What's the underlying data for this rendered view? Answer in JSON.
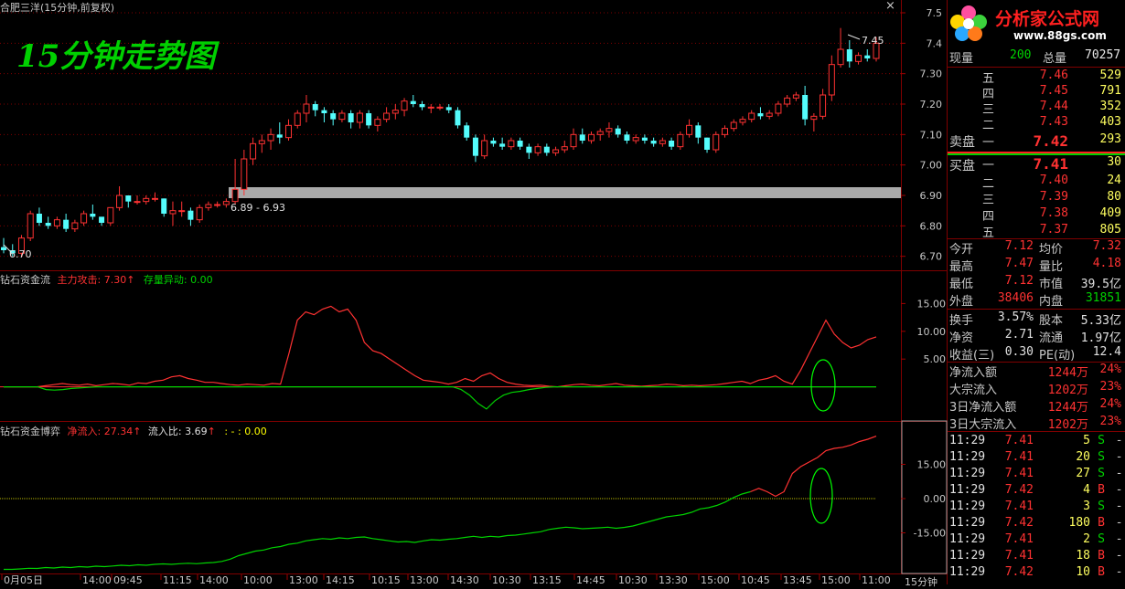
{
  "window": {
    "title": "合肥三洋(15分钟,前复权)",
    "close_label": "×"
  },
  "overlay": {
    "title": "15分钟走势图"
  },
  "watermark": {
    "brand": "分析家公式网",
    "url": "www.88gs.com"
  },
  "colors": {
    "up": "#ff3232",
    "down": "#54fcfc",
    "green": "#00d200",
    "yellow": "#ffff00",
    "grid": "#800000"
  },
  "main_chart": {
    "y_ticks": [
      "7.5",
      "7.4",
      "7.30",
      "7.20",
      "7.10",
      "7.00",
      "6.90",
      "6.80",
      "6.70"
    ],
    "high_label": "7.45",
    "low_label": "6.70",
    "band_label": "6.89 - 6.93",
    "time_label": "11:00"
  },
  "chart_data": [
    {
      "type": "candlestick",
      "title": "合肥三洋(15分钟,前复权)",
      "ylim": [
        6.66,
        7.53
      ],
      "ohlc": [
        [
          6.73,
          6.76,
          6.71,
          6.72
        ],
        [
          6.72,
          6.74,
          6.7,
          6.71
        ],
        [
          6.71,
          6.77,
          6.7,
          6.76
        ],
        [
          6.76,
          6.85,
          6.75,
          6.84
        ],
        [
          6.84,
          6.86,
          6.8,
          6.81
        ],
        [
          6.81,
          6.83,
          6.79,
          6.8
        ],
        [
          6.8,
          6.83,
          6.79,
          6.82
        ],
        [
          6.82,
          6.84,
          6.78,
          6.79
        ],
        [
          6.79,
          6.82,
          6.78,
          6.81
        ],
        [
          6.81,
          6.85,
          6.8,
          6.84
        ],
        [
          6.84,
          6.87,
          6.82,
          6.83
        ],
        [
          6.83,
          6.82,
          6.8,
          6.81
        ],
        [
          6.81,
          6.86,
          6.8,
          6.86
        ],
        [
          6.86,
          6.93,
          6.85,
          6.9
        ],
        [
          6.9,
          6.9,
          6.86,
          6.88
        ],
        [
          6.88,
          6.9,
          6.87,
          6.88
        ],
        [
          6.88,
          6.9,
          6.87,
          6.89
        ],
        [
          6.89,
          6.91,
          6.88,
          6.89
        ],
        [
          6.89,
          6.89,
          6.83,
          6.84
        ],
        [
          6.84,
          6.88,
          6.8,
          6.85
        ],
        [
          6.85,
          6.88,
          6.83,
          6.85
        ],
        [
          6.85,
          6.86,
          6.8,
          6.82
        ],
        [
          6.82,
          6.87,
          6.81,
          6.86
        ],
        [
          6.86,
          6.88,
          6.85,
          6.87
        ],
        [
          6.87,
          6.88,
          6.86,
          6.87
        ],
        [
          6.87,
          6.89,
          6.86,
          6.88
        ],
        [
          6.88,
          7.02,
          6.87,
          6.92
        ],
        [
          6.92,
          7.05,
          6.9,
          7.02
        ],
        [
          7.02,
          7.09,
          7.0,
          7.07
        ],
        [
          7.07,
          7.1,
          7.04,
          7.08
        ],
        [
          7.08,
          7.12,
          7.05,
          7.1
        ],
        [
          7.1,
          7.14,
          7.07,
          7.09
        ],
        [
          7.09,
          7.15,
          7.08,
          7.13
        ],
        [
          7.13,
          7.18,
          7.12,
          7.17
        ],
        [
          7.17,
          7.23,
          7.14,
          7.2
        ],
        [
          7.2,
          7.21,
          7.16,
          7.18
        ],
        [
          7.18,
          7.19,
          7.14,
          7.17
        ],
        [
          7.17,
          7.18,
          7.13,
          7.15
        ],
        [
          7.15,
          7.18,
          7.14,
          7.17
        ],
        [
          7.17,
          7.18,
          7.12,
          7.14
        ],
        [
          7.14,
          7.18,
          7.12,
          7.17
        ],
        [
          7.17,
          7.18,
          7.12,
          7.13
        ],
        [
          7.13,
          7.16,
          7.11,
          7.15
        ],
        [
          7.15,
          7.19,
          7.14,
          7.17
        ],
        [
          7.17,
          7.2,
          7.15,
          7.18
        ],
        [
          7.18,
          7.22,
          7.16,
          7.21
        ],
        [
          7.21,
          7.23,
          7.19,
          7.2
        ],
        [
          7.2,
          7.21,
          7.18,
          7.19
        ],
        [
          7.19,
          7.2,
          7.17,
          7.19
        ],
        [
          7.19,
          7.2,
          7.18,
          7.19
        ],
        [
          7.19,
          7.2,
          7.17,
          7.18
        ],
        [
          7.18,
          7.19,
          7.12,
          7.13
        ],
        [
          7.13,
          7.14,
          7.08,
          7.09
        ],
        [
          7.09,
          7.1,
          7.01,
          7.03
        ],
        [
          7.03,
          7.1,
          7.02,
          7.08
        ],
        [
          7.08,
          7.09,
          7.06,
          7.07
        ],
        [
          7.07,
          7.09,
          7.05,
          7.06
        ],
        [
          7.06,
          7.09,
          7.05,
          7.08
        ],
        [
          7.08,
          7.09,
          7.05,
          7.06
        ],
        [
          7.06,
          7.07,
          7.02,
          7.04
        ],
        [
          7.04,
          7.07,
          7.03,
          7.06
        ],
        [
          7.06,
          7.07,
          7.03,
          7.04
        ],
        [
          7.04,
          7.06,
          7.03,
          7.05
        ],
        [
          7.05,
          7.08,
          7.04,
          7.06
        ],
        [
          7.06,
          7.12,
          7.05,
          7.1
        ],
        [
          7.1,
          7.12,
          7.07,
          7.08
        ],
        [
          7.08,
          7.11,
          7.07,
          7.1
        ],
        [
          7.1,
          7.12,
          7.08,
          7.11
        ],
        [
          7.11,
          7.14,
          7.09,
          7.12
        ],
        [
          7.12,
          7.13,
          7.09,
          7.1
        ],
        [
          7.1,
          7.11,
          7.07,
          7.08
        ],
        [
          7.08,
          7.1,
          7.07,
          7.09
        ],
        [
          7.09,
          7.1,
          7.07,
          7.08
        ],
        [
          7.08,
          7.09,
          7.06,
          7.07
        ],
        [
          7.07,
          7.09,
          7.06,
          7.08
        ],
        [
          7.08,
          7.09,
          7.05,
          7.06
        ],
        [
          7.06,
          7.11,
          7.05,
          7.1
        ],
        [
          7.1,
          7.15,
          7.09,
          7.13
        ],
        [
          7.13,
          7.14,
          7.07,
          7.09
        ],
        [
          7.09,
          7.09,
          7.04,
          7.05
        ],
        [
          7.05,
          7.11,
          7.04,
          7.1
        ],
        [
          7.1,
          7.13,
          7.09,
          7.12
        ],
        [
          7.12,
          7.15,
          7.11,
          7.14
        ],
        [
          7.14,
          7.16,
          7.13,
          7.15
        ],
        [
          7.15,
          7.18,
          7.14,
          7.17
        ],
        [
          7.17,
          7.19,
          7.15,
          7.16
        ],
        [
          7.16,
          7.18,
          7.15,
          7.17
        ],
        [
          7.17,
          7.21,
          7.16,
          7.2
        ],
        [
          7.2,
          7.23,
          7.19,
          7.22
        ],
        [
          7.22,
          7.24,
          7.21,
          7.23
        ],
        [
          7.23,
          7.26,
          7.13,
          7.15
        ],
        [
          7.15,
          7.17,
          7.11,
          7.16
        ],
        [
          7.16,
          7.25,
          7.15,
          7.23
        ],
        [
          7.23,
          7.36,
          7.21,
          7.33
        ],
        [
          7.33,
          7.45,
          7.32,
          7.38
        ],
        [
          7.38,
          7.41,
          7.32,
          7.34
        ],
        [
          7.34,
          7.37,
          7.33,
          7.36
        ],
        [
          7.36,
          7.38,
          7.34,
          7.35
        ],
        [
          7.35,
          7.42,
          7.34,
          7.4
        ]
      ],
      "ylabel": "",
      "xlabel": ""
    },
    {
      "type": "line",
      "title": "钻石资金流",
      "ylim": [
        -5,
        20
      ],
      "y_ticks": [
        15.0,
        10.0,
        5.0
      ],
      "series": [
        {
          "name": "主力攻击",
          "color": "red",
          "values": [
            0,
            0,
            0,
            0,
            0,
            0.2,
            0.4,
            0.6,
            0.4,
            0.3,
            0.5,
            0.2,
            0.4,
            0.6,
            0.5,
            0.3,
            0.7,
            0.6,
            1.0,
            1.2,
            1.8,
            2.0,
            1.5,
            1.2,
            0.8,
            0.8,
            0.6,
            0.4,
            0.3,
            0.5,
            0.4,
            0.3,
            0.6,
            0.5,
            6.0,
            12.0,
            13.5,
            13.0,
            14.0,
            14.5,
            13.5,
            14.0,
            12.0,
            8.0,
            6.5,
            6.0,
            5.0,
            4.0,
            3.0,
            2.0,
            1.2,
            1.0,
            0.8,
            0.5,
            0.8,
            1.5,
            1.0,
            2.0,
            2.5,
            1.5,
            0.8,
            0.5,
            0.3,
            0.2,
            0.3,
            0.1,
            0,
            0.2,
            0.4,
            0.5,
            0.3,
            0.2,
            0.4,
            0.6,
            0.3,
            0.2,
            0.1,
            0.2,
            0.3,
            0.5,
            0.4,
            0.2,
            0.3,
            0.2,
            0.3,
            0.4,
            0.6,
            0.8,
            1.0,
            0.6,
            1.2,
            1.5,
            2.0,
            1.0,
            0.5,
            3.0,
            6.0,
            9.0,
            12.0,
            9.5,
            8.0,
            7.0,
            7.5,
            8.5,
            9.0
          ]
        },
        {
          "name": "存量异动",
          "color": "green",
          "values": [
            0,
            0,
            0,
            0,
            0,
            -0.5,
            -0.6,
            -0.5,
            -0.3,
            -0.2,
            -0.1,
            0,
            0,
            0,
            0,
            0,
            0,
            0,
            0,
            0,
            0,
            0,
            0,
            0,
            0,
            0,
            0,
            0,
            0,
            0,
            0,
            0,
            0,
            0,
            0,
            0,
            0,
            0,
            0,
            0,
            0,
            0,
            0,
            0,
            0,
            0,
            0,
            0,
            0,
            0,
            0,
            0,
            0,
            0,
            -0.5,
            -1.5,
            -3.0,
            -4.0,
            -2.5,
            -1.5,
            -1.0,
            -0.8,
            -0.5,
            -0.3,
            -0.1,
            0,
            0,
            0,
            0,
            0,
            0,
            0,
            0,
            0,
            0,
            0,
            0,
            0,
            0,
            0,
            0,
            0,
            0,
            0,
            0,
            0,
            0,
            0,
            0,
            0,
            0,
            0,
            0,
            0,
            0,
            0,
            0,
            0,
            0,
            0,
            0,
            0,
            0,
            0
          ]
        }
      ],
      "xlabel": "",
      "ylabel": ""
    },
    {
      "type": "line",
      "title": "钻石资金博弈",
      "ylim": [
        -32,
        32
      ],
      "y_ticks": [
        15.0,
        0.0,
        -15.0
      ],
      "series": [
        {
          "name": "净流入",
          "color": "green",
          "values": [
            -31,
            -31,
            -30.8,
            -30.5,
            -30.6,
            -30.2,
            -30.4,
            -30.0,
            -30.2,
            -29.8,
            -30.0,
            -29.6,
            -29.8,
            -29.5,
            -29.2,
            -29.4,
            -29.0,
            -29.2,
            -28.8,
            -28.6,
            -28.8,
            -28.5,
            -28.3,
            -28.5,
            -28.2,
            -28.0,
            -27.5,
            -26.5,
            -25.0,
            -24.0,
            -23.0,
            -22.5,
            -21.5,
            -21.0,
            -20.0,
            -19.5,
            -18.5,
            -18.0,
            -17.5,
            -17.8,
            -17.2,
            -17.5,
            -17.0,
            -16.8,
            -17.5,
            -18.0,
            -18.5,
            -19.0,
            -18.8,
            -19.2,
            -18.5,
            -18.0,
            -18.2,
            -17.8,
            -17.5,
            -17.0,
            -16.5,
            -17.0,
            -16.5,
            -16.8,
            -16.2,
            -16.0,
            -15.5,
            -15.0,
            -14.5,
            -13.5,
            -13.0,
            -12.5,
            -12.8,
            -13.2,
            -13.0,
            -12.8,
            -12.5,
            -13.0,
            -12.6,
            -12.0,
            -11.0,
            -10.0,
            -9.0,
            -8.0,
            -7.5,
            -7.0,
            -6.0,
            -4.5,
            -4.0,
            -3.0,
            -1.5,
            0.5,
            2.0,
            3.0,
            4.5,
            3.0,
            1.0,
            3.0,
            11.0,
            14.0,
            16.0,
            18.0,
            21.0,
            22.0,
            22.5,
            23.5,
            25.0,
            26.0,
            27.34
          ]
        }
      ],
      "xlabel": "",
      "ylabel": ""
    }
  ],
  "indicator1": {
    "name": "钻石资金流",
    "item1_label": "主力攻击: 7.30",
    "item1_arrow": "↑",
    "item2_label": "存量异动: 0.00",
    "y_ticks": [
      "15.00",
      "10.00",
      "5.00"
    ]
  },
  "indicator2": {
    "name": "钻石资金博弈",
    "item1_label": "净流入: 27.34",
    "item1_arrow": "↑",
    "item2_label": "流入比: 3.69",
    "item2_arrow": "↑",
    "item3_label": ": - : 0.00",
    "y_ticks": [
      "15.00",
      "0.00",
      "-15.00"
    ]
  },
  "x_axis": {
    "labels": [
      "0月05日",
      "14:00",
      "09:45",
      "11:15",
      "14:00",
      "10:00",
      "13:00",
      "14:15",
      "10:15",
      "13:00",
      "14:30",
      "10:30",
      "13:15",
      "14:45",
      "10:30",
      "13:30",
      "15:00",
      "10:45",
      "13:45",
      "15:00",
      "11:00"
    ],
    "period_label": "15分钟"
  },
  "quote": {
    "top": {
      "label_a": "现量",
      "value_a": "200",
      "label_b": "总量",
      "value_b": "70257"
    },
    "sell": [
      {
        "name": "五",
        "price": "7.46",
        "vol": "529"
      },
      {
        "name": "四",
        "price": "7.45",
        "vol": "791"
      },
      {
        "name": "三",
        "price": "7.44",
        "vol": "352"
      },
      {
        "name": "二",
        "price": "7.43",
        "vol": "403"
      },
      {
        "name": "一",
        "price": "7.42",
        "vol": "293"
      }
    ],
    "sell_label": "卖盘",
    "buy_label": "买盘",
    "buy": [
      {
        "name": "一",
        "price": "7.41",
        "vol": "30"
      },
      {
        "name": "二",
        "price": "7.40",
        "vol": "24"
      },
      {
        "name": "三",
        "price": "7.39",
        "vol": "80"
      },
      {
        "name": "四",
        "price": "7.38",
        "vol": "409"
      },
      {
        "name": "五",
        "price": "7.37",
        "vol": "805"
      }
    ],
    "stats1": [
      {
        "l1": "今开",
        "v1": "7.12",
        "l2": "均价",
        "v2": "7.32"
      },
      {
        "l1": "最高",
        "v1": "7.47",
        "l2": "量比",
        "v2": "4.18"
      },
      {
        "l1": "最低",
        "v1": "7.12",
        "l2": "市值",
        "v2": "39.5亿"
      },
      {
        "l1": "外盘",
        "v1": "38406",
        "l2": "内盘",
        "v2": "31851"
      }
    ],
    "stats2": [
      {
        "l1": "换手",
        "v1": "3.57%",
        "l2": "股本",
        "v2": "5.33亿"
      },
      {
        "l1": "净资",
        "v1": "2.71",
        "l2": "流通",
        "v2": "1.97亿"
      },
      {
        "l1": "收益(三)",
        "v1": "0.30",
        "l2": "PE(动)",
        "v2": "12.4"
      }
    ],
    "flows": [
      {
        "label": "净流入额",
        "value": "1244万",
        "pct": "24%"
      },
      {
        "label": "大宗流入",
        "value": "1202万",
        "pct": "23%"
      },
      {
        "label": "3日净流入额",
        "value": "1244万",
        "pct": "24%"
      },
      {
        "label": "3日大宗流入",
        "value": "1202万",
        "pct": "23%"
      }
    ],
    "ticks": [
      {
        "time": "11:29",
        "price": "7.41",
        "vol": "5",
        "side": "S"
      },
      {
        "time": "11:29",
        "price": "7.41",
        "vol": "20",
        "side": "S"
      },
      {
        "time": "11:29",
        "price": "7.41",
        "vol": "27",
        "side": "S"
      },
      {
        "time": "11:29",
        "price": "7.42",
        "vol": "4",
        "side": "B"
      },
      {
        "time": "11:29",
        "price": "7.41",
        "vol": "3",
        "side": "S"
      },
      {
        "time": "11:29",
        "price": "7.42",
        "vol": "180",
        "side": "B"
      },
      {
        "time": "11:29",
        "price": "7.41",
        "vol": "2",
        "side": "S"
      },
      {
        "time": "11:29",
        "price": "7.41",
        "vol": "18",
        "side": "B"
      },
      {
        "time": "11:29",
        "price": "7.42",
        "vol": "10",
        "side": "B"
      }
    ]
  }
}
